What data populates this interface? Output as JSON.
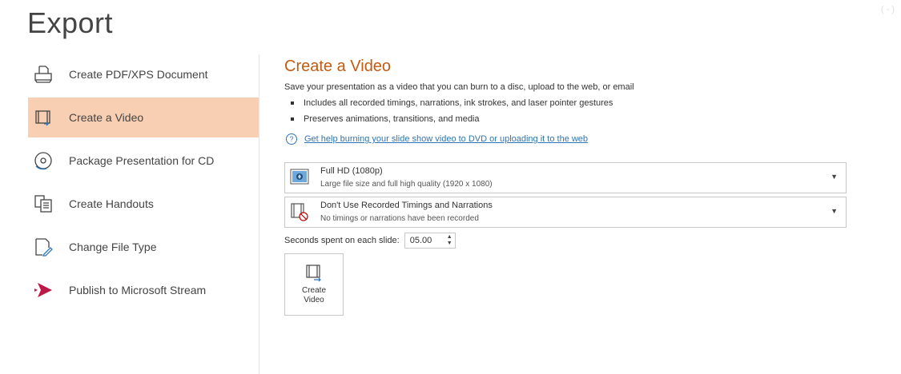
{
  "page": {
    "title": "Export",
    "corner_mark": "( - )"
  },
  "sidebar": {
    "items": [
      {
        "label": "Create PDF/XPS Document",
        "icon": "pdf-document-icon"
      },
      {
        "label": "Create a Video",
        "icon": "video-icon",
        "selected": true
      },
      {
        "label": "Package Presentation for CD",
        "icon": "cd-disc-icon"
      },
      {
        "label": "Create Handouts",
        "icon": "handouts-icon"
      },
      {
        "label": "Change File Type",
        "icon": "change-file-type-icon"
      },
      {
        "label": "Publish to Microsoft Stream",
        "icon": "microsoft-stream-icon"
      }
    ]
  },
  "main": {
    "title": "Create a Video",
    "description": "Save your presentation as a video that you can burn to a disc, upload to the web, or email",
    "bullets": [
      "Includes all recorded timings, narrations, ink strokes, and laser pointer gestures",
      "Preserves animations, transitions, and media"
    ],
    "help_link": "Get help burning your slide show video to DVD or uploading it to the web",
    "quality_dropdown": {
      "title": "Full HD (1080p)",
      "subtitle": "Large file size and full high quality (1920 x 1080)"
    },
    "timings_dropdown": {
      "title": "Don't Use Recorded Timings and Narrations",
      "subtitle": "No timings or narrations have been recorded"
    },
    "seconds_label": "Seconds spent on each slide:",
    "seconds_value": "05.00",
    "create_button": "Create Video"
  },
  "colors": {
    "accent": "#c55a11",
    "selected_bg": "#f8cfb3",
    "link": "#2e75b6"
  }
}
